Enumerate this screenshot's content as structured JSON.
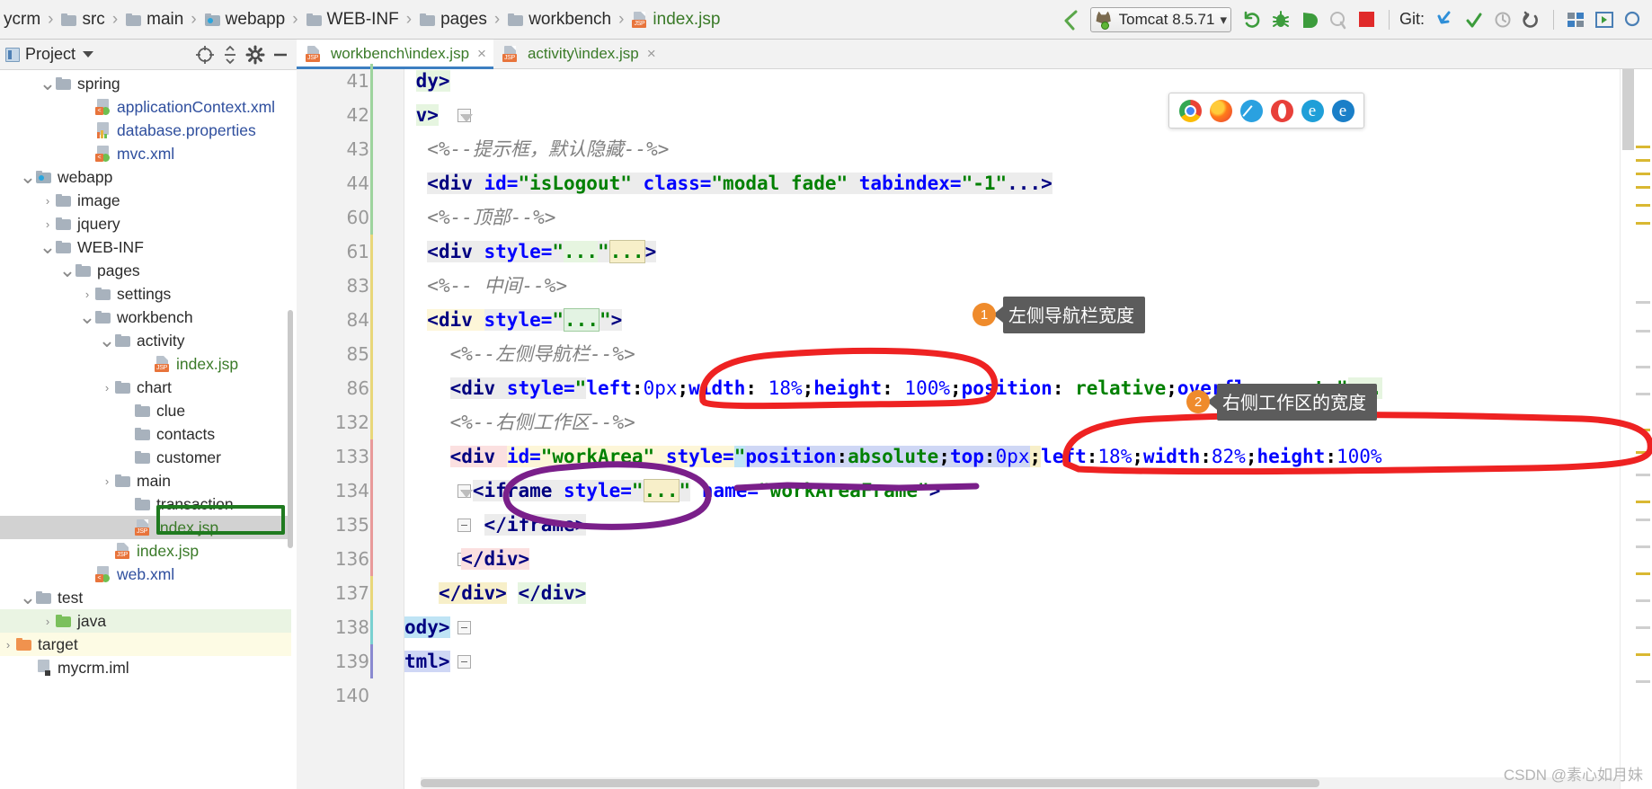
{
  "breadcrumb": [
    {
      "label": "ycrm",
      "icon": "none"
    },
    {
      "label": "src",
      "icon": "folder-icon"
    },
    {
      "label": "main",
      "icon": "folder-icon"
    },
    {
      "label": "webapp",
      "icon": "web-folder-icon"
    },
    {
      "label": "WEB-INF",
      "icon": "folder-icon"
    },
    {
      "label": "pages",
      "icon": "folder-icon"
    },
    {
      "label": "workbench",
      "icon": "folder-icon"
    },
    {
      "label": "index.jsp",
      "icon": "jsp-file-icon"
    }
  ],
  "toolbar": {
    "back_arrow_label": "",
    "run_config": "Tomcat 8.5.71",
    "run_config_dropdown": "v",
    "buttons": [
      {
        "name": "rerun-button",
        "glyph": "↻"
      },
      {
        "name": "debug-button",
        "glyph": "⚙"
      },
      {
        "name": "run-with-coverage-button",
        "glyph": "▷"
      },
      {
        "name": "profile-button",
        "glyph": "◎"
      },
      {
        "name": "stop-button",
        "glyph": "■"
      }
    ],
    "git_label": "Git:",
    "git_buttons": [
      {
        "name": "git-update-project-button",
        "glyph": "↙"
      },
      {
        "name": "git-commit-button",
        "glyph": "✓"
      },
      {
        "name": "git-history-button",
        "glyph": "◴"
      },
      {
        "name": "git-rollback-button",
        "glyph": "↶"
      }
    ],
    "right_buttons": [
      {
        "name": "project-structure-button",
        "glyph": "▤"
      },
      {
        "name": "select-opened-file-button",
        "glyph": "▷"
      },
      {
        "name": "search-everywhere-button",
        "glyph": "○"
      }
    ]
  },
  "project_panel": {
    "title": "Project",
    "caret": "▾",
    "tools": [
      {
        "name": "select-opened-file-icon",
        "glyph": "⊕"
      },
      {
        "name": "collapse-all-icon",
        "glyph": "⤓"
      },
      {
        "name": "settings-gear-icon",
        "glyph": "⚙"
      },
      {
        "name": "hide-panel-icon",
        "glyph": "—"
      }
    ]
  },
  "tree": [
    {
      "label": "spring",
      "indent": 3,
      "arrow": "down",
      "icon": "folder-icon",
      "style": "plain"
    },
    {
      "label": "applicationContext.xml",
      "indent": 5,
      "arrow": "none",
      "icon": "xml-file-icon",
      "style": "blue"
    },
    {
      "label": "database.properties",
      "indent": 5,
      "arrow": "none",
      "icon": "properties-file-icon",
      "style": "blue"
    },
    {
      "label": "mvc.xml",
      "indent": 5,
      "arrow": "none",
      "icon": "xml-file-icon",
      "style": "blue"
    },
    {
      "label": "webapp",
      "indent": 2,
      "arrow": "down",
      "icon": "web-folder-icon",
      "style": "plain"
    },
    {
      "label": "image",
      "indent": 3,
      "arrow": "right",
      "icon": "folder-icon",
      "style": "plain"
    },
    {
      "label": "jquery",
      "indent": 3,
      "arrow": "right",
      "icon": "folder-icon",
      "style": "plain"
    },
    {
      "label": "WEB-INF",
      "indent": 3,
      "arrow": "down",
      "icon": "folder-icon",
      "style": "plain"
    },
    {
      "label": "pages",
      "indent": 4,
      "arrow": "down",
      "icon": "folder-icon",
      "style": "plain"
    },
    {
      "label": "settings",
      "indent": 5,
      "arrow": "right",
      "icon": "folder-icon",
      "style": "plain"
    },
    {
      "label": "workbench",
      "indent": 5,
      "arrow": "down",
      "icon": "folder-icon",
      "style": "plain"
    },
    {
      "label": "activity",
      "indent": 6,
      "arrow": "down",
      "icon": "folder-icon",
      "style": "plain"
    },
    {
      "label": "index.jsp",
      "indent": 8,
      "arrow": "none",
      "icon": "jsp-file-icon",
      "style": "green"
    },
    {
      "label": "chart",
      "indent": 6,
      "arrow": "right",
      "icon": "folder-icon",
      "style": "plain"
    },
    {
      "label": "clue",
      "indent": 7,
      "arrow": "none",
      "icon": "folder-icon",
      "style": "plain"
    },
    {
      "label": "contacts",
      "indent": 7,
      "arrow": "none",
      "icon": "folder-icon",
      "style": "plain"
    },
    {
      "label": "customer",
      "indent": 7,
      "arrow": "none",
      "icon": "folder-icon",
      "style": "plain"
    },
    {
      "label": "main",
      "indent": 6,
      "arrow": "right",
      "icon": "folder-icon",
      "style": "plain"
    },
    {
      "label": "transaction",
      "indent": 7,
      "arrow": "none",
      "icon": "folder-icon",
      "style": "plain"
    },
    {
      "label": "index.jsp",
      "indent": 7,
      "arrow": "none",
      "icon": "jsp-file-icon",
      "style": "selected-green"
    },
    {
      "label": "index.jsp",
      "indent": 6,
      "arrow": "none",
      "icon": "jsp-file-icon",
      "style": "green"
    },
    {
      "label": "web.xml",
      "indent": 5,
      "arrow": "none",
      "icon": "xml-file-icon",
      "style": "blue"
    },
    {
      "label": "test",
      "indent": 2,
      "arrow": "down",
      "icon": "folder-icon",
      "style": "plain"
    },
    {
      "label": "java",
      "indent": 3,
      "arrow": "right",
      "icon": "green-folder-icon",
      "style": "row-green"
    },
    {
      "label": "target",
      "indent": 1,
      "arrow": "right",
      "icon": "orange-folder-icon",
      "style": "row-yellow"
    },
    {
      "label": "mycrm.iml",
      "indent": 2,
      "arrow": "none",
      "icon": "iml-file-icon",
      "style": "plain"
    }
  ],
  "editor": {
    "tabs": [
      {
        "label": "workbench\\index.jsp",
        "active": true,
        "close": "×"
      },
      {
        "label": "activity\\index.jsp",
        "active": false,
        "close": "×"
      }
    ],
    "lines": [
      {
        "num": "41",
        "text": "dy>"
      },
      {
        "num": "42",
        "text": "v>"
      },
      {
        "num": "43",
        "text": "<%--提示框，默认隐藏--%>"
      },
      {
        "num": "44",
        "text": "<div id=\"isLogout\" class=\"modal fade\" tabindex=\"-1\"...>"
      },
      {
        "num": "60",
        "text": "<%--顶部--%>"
      },
      {
        "num": "61",
        "text": "<div style=\"...\"...>"
      },
      {
        "num": "83",
        "text": "<%-- 中间--%>"
      },
      {
        "num": "84",
        "text": "<div style=\"...\">"
      },
      {
        "num": "85",
        "text": "<%--左侧导航栏--%>"
      },
      {
        "num": "86",
        "text": "<div style=\"left:0px;width: 18%;height: 100%;position: relative;overflow: auto\"..."
      },
      {
        "num": "132",
        "text": "<%--右侧工作区--%>"
      },
      {
        "num": "133",
        "text": "<div id=\"workArea\" style=\"position:absolute;top:0px;left:18%;width:82%;height:100%"
      },
      {
        "num": "134",
        "text": "<iframe style=\"...\" name=\"workAreaFrame\">"
      },
      {
        "num": "135",
        "text": "</iframe>"
      },
      {
        "num": "136",
        "text": "</div>"
      },
      {
        "num": "137",
        "text": "</div> </div>"
      },
      {
        "num": "138",
        "text": "ody>"
      },
      {
        "num": "139",
        "text": "tml>"
      },
      {
        "num": "140",
        "text": ""
      }
    ]
  },
  "browser_popup": {
    "icons": [
      "chrome-icon",
      "firefox-icon",
      "safari-icon",
      "opera-icon",
      "edge-legacy-icon",
      "ie-icon"
    ]
  },
  "annotations": [
    {
      "num": "1",
      "text": "左侧导航栏宽度",
      "color": "#ef8b2c"
    },
    {
      "num": "2",
      "text": "右侧工作区的宽度",
      "color": "#ef8b2c"
    }
  ],
  "annotation_colors": {
    "red_ellipse": "#ee2222",
    "purple_ellipse": "#7a1f8a",
    "green_box": "#1f7a1f"
  },
  "watermark": "CSDN @素心如月妹"
}
